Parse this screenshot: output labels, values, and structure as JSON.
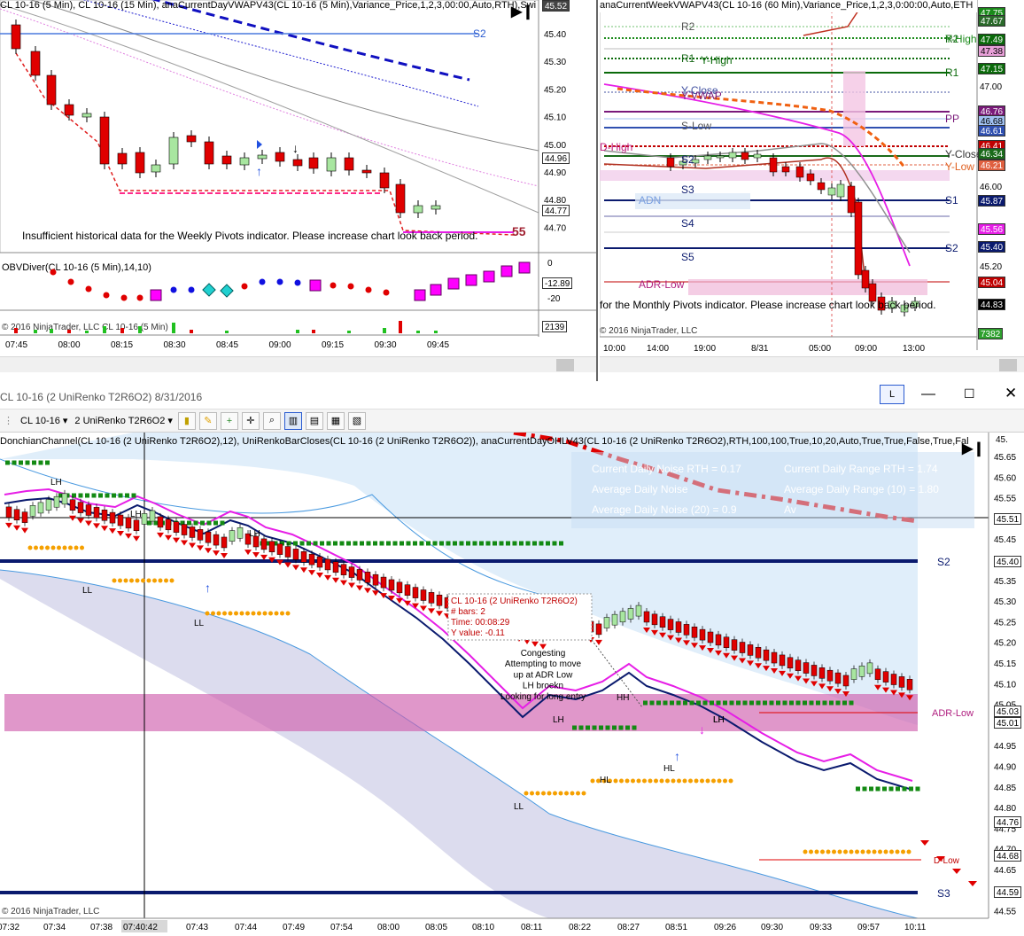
{
  "top_left": {
    "title": "CL 10-16 (5 Min), CL 10-16 (15 Min), anaCurrentDayVWAPV43(CL 10-16 (5 Min),Variance_Price,1,2,3,00:00,Auto,RTH),Swi",
    "price_badge": "45.52",
    "pivot_label": "S2",
    "y_ticks": [
      "45.40",
      "45.30",
      "45.20",
      "45.10",
      "45.00",
      "44.90",
      "44.80",
      "44.70"
    ],
    "tag_price1": "44.96",
    "tag_price2": "44.77",
    "message": "Insufficient historical data for the Weekly Pivots indicator. Please increase chart look back period.",
    "count_label": "55",
    "obv_title": "OBVDiver(CL 10-16 (5 Min),14,10)",
    "obv_ticks": [
      "0",
      "-20"
    ],
    "obv_value": "-12.89",
    "vol_title": "© 2016 NinjaTrader, LLC  CL 10-16 (5 Min)",
    "vol_value": "2139",
    "x_ticks": [
      "07:45",
      "08:00",
      "08:15",
      "08:30",
      "08:45",
      "09:00",
      "09:15",
      "09:30",
      "09:45"
    ]
  },
  "top_right": {
    "title": "anaCurrentWeekVWAPV43(CL 10-16 (60 Min),Variance_Price,1,2,3,0:00:00,Auto,ETH",
    "level_labels": [
      "R2",
      "Y-High",
      "R1",
      "PP",
      "Y-Close",
      "Y-Low",
      "S1",
      "S2"
    ],
    "inner_labels": [
      "R2",
      "R1",
      "Y-High",
      "Y-Close",
      "Y-VWAP",
      "S-Low",
      "S2",
      "S3",
      "S4",
      "S5",
      "ADR-Low",
      "ADN",
      "D-High"
    ],
    "price_tags": [
      "47.75",
      "47.67",
      "47.49",
      "47.38",
      "47.15",
      "47.00",
      "46.76",
      "46.68",
      "46.61",
      "46.41",
      "46.34",
      "46.21",
      "46.00",
      "45.87",
      "45.56",
      "45.40",
      "45.20",
      "45.04",
      "44.83"
    ],
    "message": "for the Monthly Pivots indicator. Please increase chart look back period.",
    "copyright": "© 2016 NinjaTrader, LLC",
    "vol_value": "7382",
    "x_ticks": [
      "10:00",
      "14:00",
      "19:00",
      "8/31",
      "05:00",
      "09:00",
      "13:00"
    ]
  },
  "bottom": {
    "window_title": "CL 10-16 (2 UniRenko T2R6O2)  8/31/2016",
    "badge": "L",
    "toolbar": {
      "instrument": "CL 10-16",
      "bar_type": "2 UniRenko T2R6O2"
    },
    "indicator_title": "DonchianChannel(CL 10-16 (2 UniRenko T2R6O2),12), UniRenkoBarCloses(CL 10-16 (2 UniRenko T2R6O2)), anaCurrentDayOHLV43(CL 10-16 (2 UniRenko T2R6O2),RTH,100,100,True,10,20,Auto,True,True,False,True,Fal",
    "info_box": [
      [
        "Current Daily Noise RTH = 0.17",
        "Current Daily Range RTH = 1.74"
      ],
      [
        "Average Daily Noise",
        "Average Daily Range (10) = 1.80"
      ],
      [
        "Average Daily Noise (20) = 0.9",
        "Av"
      ]
    ],
    "y_ticks": [
      "45.65",
      "45.60",
      "45.55",
      "45.50",
      "45.45",
      "45.40",
      "45.35",
      "45.30",
      "45.25",
      "45.20",
      "45.15",
      "45.10",
      "45.05",
      "45.00",
      "44.95",
      "44.90",
      "44.85",
      "44.80",
      "44.75",
      "44.70",
      "44.65",
      "44.60",
      "44.55"
    ],
    "top_tick": "45.",
    "price_tags": [
      "45.51",
      "45.40",
      "45.03",
      "45.01",
      "44.76",
      "44.68",
      "44.59"
    ],
    "pivot_labels": {
      "s2": "S2",
      "s3": "S3",
      "adr_low": "ADR-Low",
      "d_low": "D-Low"
    },
    "swing_labels": [
      "LH",
      "LH",
      "LL",
      "LL",
      "LH",
      "LH",
      "LL",
      "LH",
      "HH",
      "LH",
      "HL",
      "HL"
    ],
    "tooltip": {
      "title": "CL 10-16 (2 UniRenko T2R6O2)",
      "bars": "# bars:   2",
      "time": "Time:     00:08:29",
      "yval": "Y value:  -0.11"
    },
    "note": [
      "Congesting",
      "Attempting to move",
      "up at ADR Low",
      "LH broekn",
      "Looking for long entry"
    ],
    "copyright": "© 2016 NinjaTrader, LLC",
    "x_ticks": [
      "07:32",
      "07:34",
      "07:38",
      "07:40:42",
      "07:43",
      "07:44",
      "07:49",
      "07:54",
      "08:00",
      "08:05",
      "08:10",
      "08:11",
      "08:22",
      "08:27",
      "08:51",
      "09:26",
      "09:30",
      "09:33",
      "09:57",
      "10:11"
    ]
  },
  "colors": {
    "up_candle": "#a8e6a0",
    "down_candle": "#e00000",
    "pivot_blue": "#0a1a6e",
    "magenta": "#e61ee6",
    "adr_band": "#d87ab8",
    "channel_fill": "#d6e8f8",
    "donchian_low_fill": "#d8d8ec",
    "green_dots": "#138a13",
    "orange_dots": "#f5a000"
  }
}
